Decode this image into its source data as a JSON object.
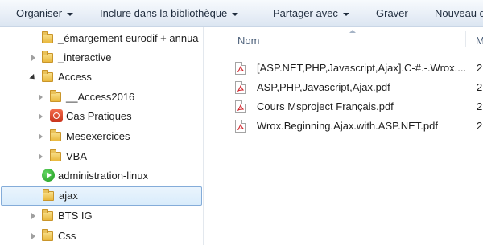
{
  "toolbar": {
    "organise": "Organiser",
    "include": "Inclure dans la bibliothèque",
    "share": "Partager avec",
    "burn": "Graver",
    "new_folder": "Nouveau d"
  },
  "tree": {
    "items": [
      {
        "label": "_émargement eurodif + annua",
        "icon": "folder-icon",
        "expander": "none"
      },
      {
        "label": "_interactive",
        "icon": "folder-icon",
        "expander": "collapsed"
      },
      {
        "label": "Access",
        "icon": "folder-icon",
        "expander": "expanded"
      },
      {
        "label": "__Access2016",
        "icon": "folder-icon",
        "expander": "collapsed"
      },
      {
        "label": "Cas Pratiques",
        "icon": "app-icon",
        "expander": "collapsed"
      },
      {
        "label": "Mesexercices",
        "icon": "folder-icon",
        "expander": "collapsed"
      },
      {
        "label": "VBA",
        "icon": "folder-icon",
        "expander": "collapsed"
      },
      {
        "label": "administration-linux",
        "icon": "play-icon",
        "expander": "none"
      },
      {
        "label": "ajax",
        "icon": "folder-icon",
        "expander": "none",
        "selected": true
      },
      {
        "label": "BTS IG",
        "icon": "folder-icon",
        "expander": "collapsed"
      },
      {
        "label": "Css",
        "icon": "folder-icon",
        "expander": "collapsed"
      }
    ]
  },
  "content": {
    "column_name": "Nom",
    "column_next": "M",
    "files": [
      {
        "name": "[ASP.NET,PHP,Javascript,Ajax].C-#.-.Wrox....",
        "date": "2"
      },
      {
        "name": "ASP,PHP,Javascript,Ajax.pdf",
        "date": "2"
      },
      {
        "name": "Cours Msproject Français.pdf",
        "date": "2"
      },
      {
        "name": "Wrox.Beginning.Ajax.with.ASP.NET.pdf",
        "date": "2"
      }
    ]
  },
  "colors": {
    "toolbar_top": "#f7fafd",
    "toolbar_bottom": "#dce6f2",
    "selection_border": "#84acd9",
    "header_text": "#4c607a",
    "pdf_red": "#d2232a"
  }
}
